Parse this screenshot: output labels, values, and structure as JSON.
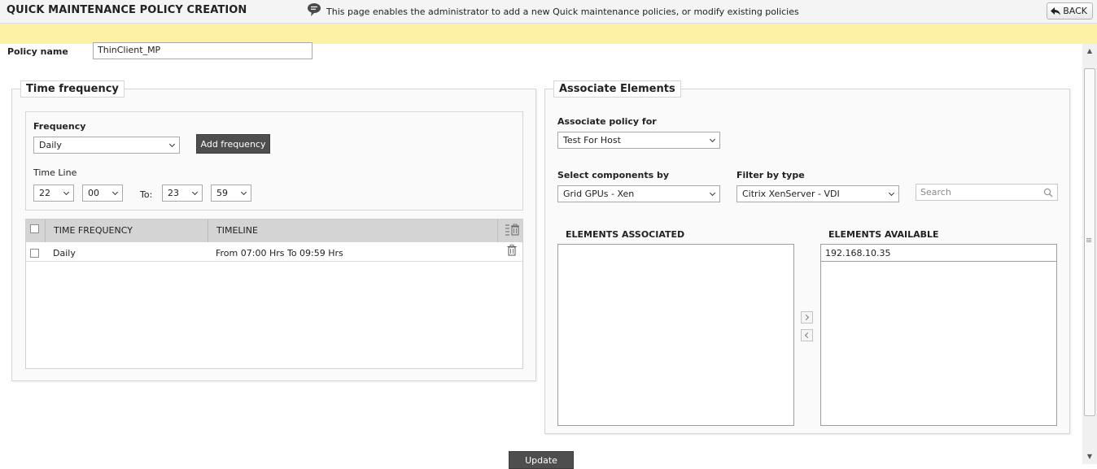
{
  "header": {
    "title": "QUICK MAINTENANCE POLICY CREATION",
    "back_label": "BACK"
  },
  "info": {
    "text": "This page enables the administrator to add a new Quick maintenance policies, or modify existing policies"
  },
  "policy": {
    "label": "Policy name",
    "value": "ThinClient_MP"
  },
  "time_frequency": {
    "legend": "Time frequency",
    "frequency_label": "Frequency",
    "frequency_value": "Daily",
    "add_button": "Add frequency",
    "timeline_label": "Time Line",
    "start_hour": "22",
    "start_minute": "00",
    "to_label": "To:",
    "end_hour": "23",
    "end_minute": "59",
    "table": {
      "columns": [
        "TIME FREQUENCY",
        "TIMELINE"
      ],
      "rows": [
        {
          "frequency": "Daily",
          "timeline": "From 07:00 Hrs To 09:59 Hrs"
        }
      ]
    }
  },
  "associate": {
    "legend": "Associate Elements",
    "policy_for_label": "Associate policy for",
    "policy_for_value": "Test For Host",
    "components_label": "Select components by",
    "components_value": "Grid GPUs - Xen",
    "filter_label": "Filter by type",
    "filter_value": "Citrix XenServer - VDI",
    "search_placeholder": "Search",
    "associated_header": "ELEMENTS ASSOCIATED",
    "available_header": "ELEMENTS AVAILABLE",
    "available_items": [
      "192.168.10.35"
    ]
  },
  "footer": {
    "update_label": "Update"
  },
  "colors": {
    "info_bar": "#fdf1a6",
    "dark_button": "#4e4e4e",
    "table_header": "#d4d4d4"
  }
}
